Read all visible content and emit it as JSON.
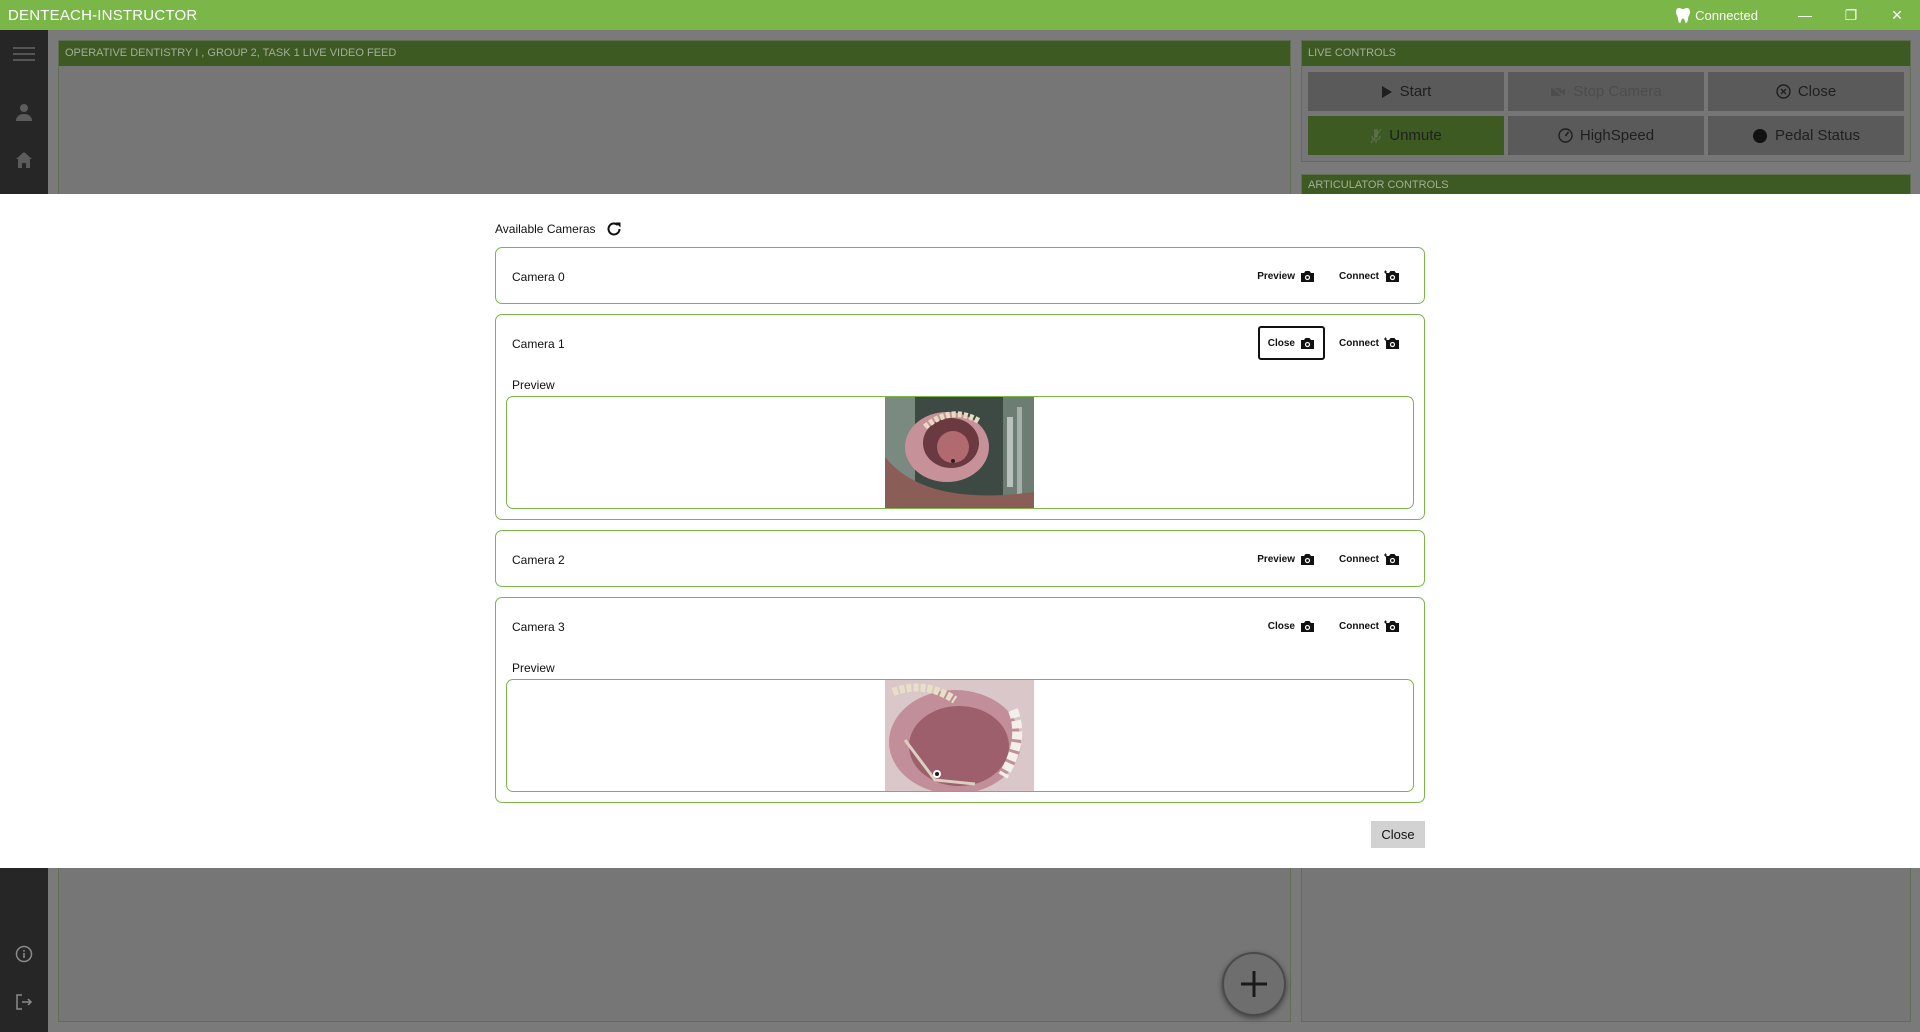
{
  "app": {
    "title": "DENTEACH-INSTRUCTOR",
    "connection_status": "Connected"
  },
  "window_controls": {
    "minimize": "—",
    "restore": "❐",
    "close": "✕"
  },
  "sidebar": {
    "icons": [
      "menu-icon",
      "user-icon",
      "home-icon",
      "info-icon",
      "logout-icon"
    ]
  },
  "video_panel": {
    "title": "OPERATIVE DENTISTRY I , GROUP 2, TASK 1 LIVE VIDEO FEED"
  },
  "live_controls": {
    "title": "LIVE CONTROLS",
    "buttons": {
      "start": "Start",
      "stop_camera": "Stop Camera",
      "close": "Close",
      "unmute": "Unmute",
      "highspeed": "HighSpeed",
      "pedal_status": "Pedal Status"
    }
  },
  "articulator_controls": {
    "title": "ARTICULATOR CONTROLS"
  },
  "modal": {
    "available_cameras_label": "Available Cameras",
    "cameras": [
      {
        "name": "Camera 0",
        "preview_button": "Preview",
        "connect_button": "Connect"
      },
      {
        "name": "Camera 1",
        "preview_button": "Close",
        "connect_button": "Connect",
        "preview_label": "Preview"
      },
      {
        "name": "Camera 2",
        "preview_button": "Preview",
        "connect_button": "Connect"
      },
      {
        "name": "Camera 3",
        "preview_button": "Close",
        "connect_button": "Connect",
        "preview_label": "Preview"
      }
    ],
    "close_button": "Close"
  },
  "colors": {
    "accent": "#7ab648",
    "dark_accent": "#3d5a22",
    "sidebar": "#262626"
  }
}
